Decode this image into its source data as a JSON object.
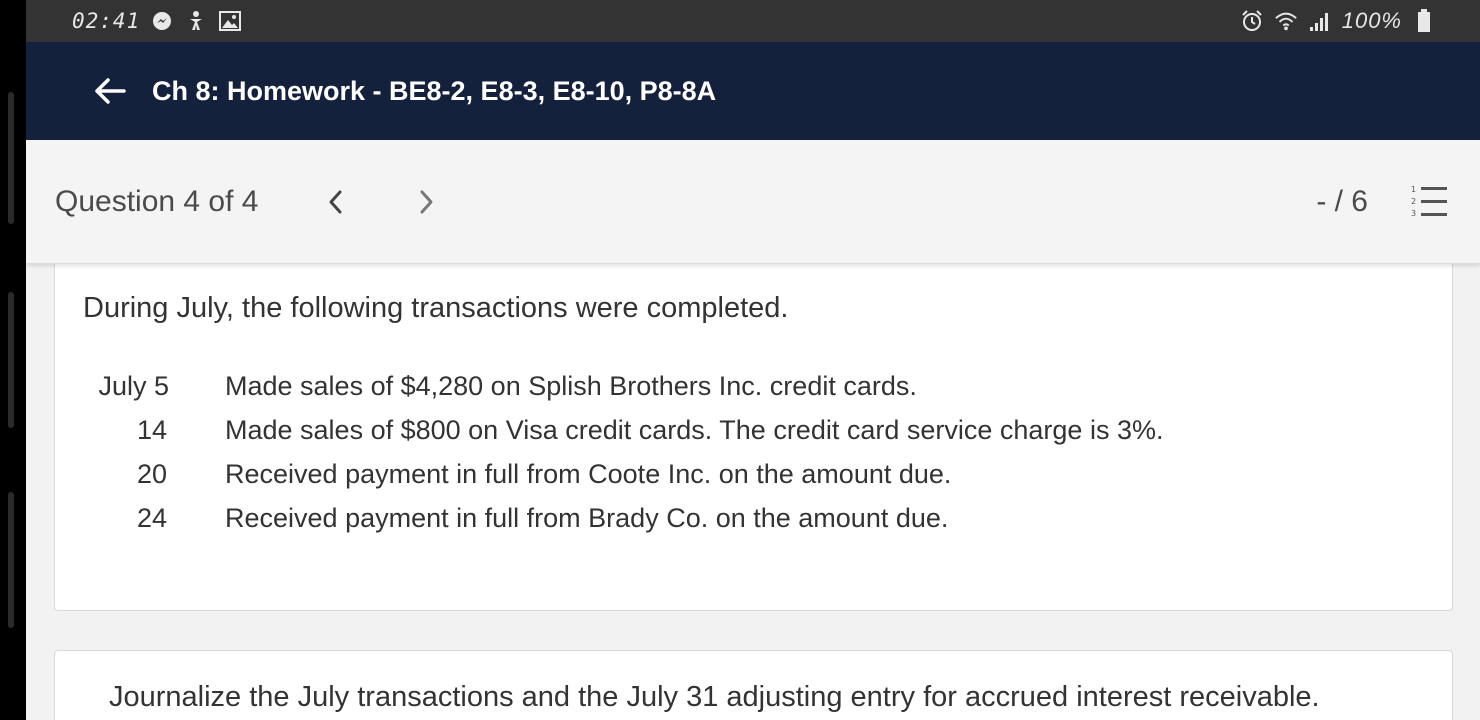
{
  "status_bar": {
    "time": "02:41",
    "battery": "100%",
    "icons": [
      "messenger-icon",
      "accessibility-icon",
      "image-icon",
      "alarm-icon",
      "wifi-icon",
      "signal-icon",
      "battery-icon"
    ]
  },
  "app_bar": {
    "title": "Ch 8: Homework - BE8-2, E8-3, E8-10, P8-8A",
    "back_icon": "back-arrow-icon"
  },
  "question_nav": {
    "label": "Question 4 of 4",
    "score": "- / 6",
    "prev_icon": "chevron-left-icon",
    "next_icon": "chevron-right-icon",
    "list_icon": "numbered-list-icon"
  },
  "question": {
    "intro": "During July, the following transactions were completed.",
    "transactions": [
      {
        "date": "July 5",
        "description": "Made sales of $4,280 on Splish Brothers Inc. credit cards."
      },
      {
        "date": "14",
        "description": "Made sales of $800 on Visa credit cards. The credit card service charge is 3%."
      },
      {
        "date": "20",
        "description": "Received payment in full from Coote Inc. on the amount due."
      },
      {
        "date": "24",
        "description": "Received payment in full from Brady Co. on the amount due."
      }
    ]
  },
  "part": {
    "instruction": "Journalize the July transactions and the July 31 adjusting entry for accrued interest receivable."
  },
  "colors": {
    "status_bar": "#333333",
    "app_bar": "#14213d",
    "nav_bg": "#f4f4f4",
    "text": "#333333"
  }
}
